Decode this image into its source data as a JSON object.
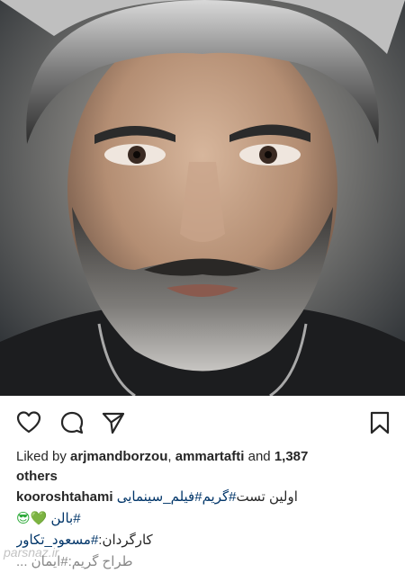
{
  "post": {
    "image_alt": "portrait",
    "likes": {
      "prefix": "Liked by ",
      "user1": "arjmandborzou",
      "sep": ", ",
      "user2": "ammartafti",
      "and_text": " and ",
      "count": "1,387",
      "suffix": "others"
    },
    "caption": {
      "username": "kooroshtahami",
      "line1_text": "اولین تست",
      "line1_tags": "#گریم#فیلم_سینمایی",
      "line2_tag": "#بالن",
      "line2_emoji": "😎💚",
      "line3_label": "کارگردان:",
      "line3_tag": "#مسعود_تکاور",
      "line4_partial": "طراح گریم:#ایمان ..."
    }
  },
  "icons": {
    "like": "heart-icon",
    "comment": "comment-icon",
    "share": "send-icon",
    "save": "bookmark-icon"
  },
  "watermark": "parsnaz.ir"
}
